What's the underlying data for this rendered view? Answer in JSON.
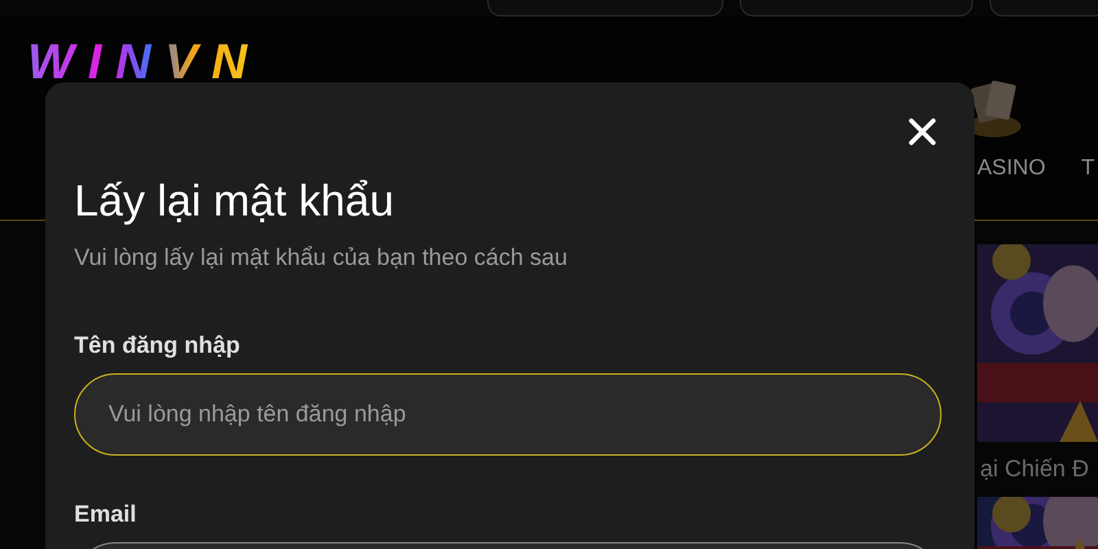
{
  "header": {
    "logo": "WINVN",
    "nav": [
      {
        "label": "ASINO"
      },
      {
        "label": "T"
      }
    ]
  },
  "games": [
    {
      "kind": "picture",
      "title": "ại Chiến Đ"
    },
    {
      "kind": "picture"
    }
  ],
  "modal": {
    "title": "Lấy lại mật khẩu",
    "subtitle": "Vui lòng lấy lại mật khẩu của bạn theo cách sau",
    "fields": [
      {
        "label": "Tên đăng nhập",
        "placeholder": "Vui lòng nhập tên đăng nhập",
        "focused": true
      },
      {
        "label": "Email",
        "focused": false
      }
    ]
  }
}
